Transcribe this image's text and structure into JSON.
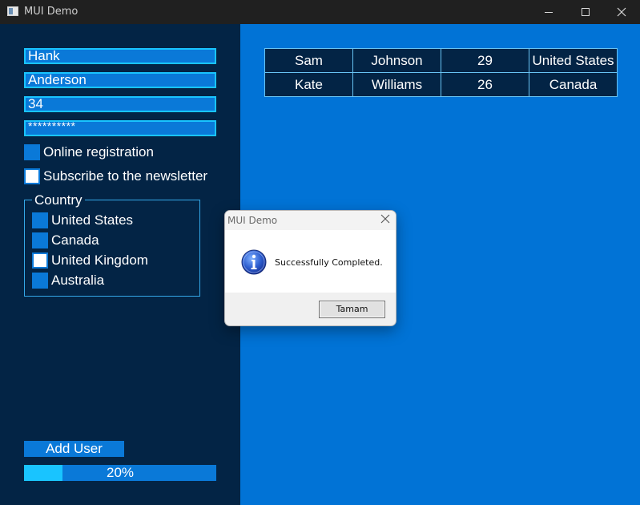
{
  "window": {
    "title": "MUI Demo"
  },
  "form": {
    "first_name": "Hank",
    "last_name": "Anderson",
    "age": "34",
    "password": "**********",
    "online_registration_label": "Online registration",
    "online_registration_checked": false,
    "newsletter_label": "Subscribe to the newsletter",
    "newsletter_checked": true
  },
  "country_group": {
    "title": "Country",
    "options": [
      {
        "label": "United States",
        "selected": false
      },
      {
        "label": "Canada",
        "selected": false
      },
      {
        "label": "United Kingdom",
        "selected": true
      },
      {
        "label": "Australia",
        "selected": false
      }
    ]
  },
  "actions": {
    "add_user_label": "Add User"
  },
  "progress": {
    "value": 0.2,
    "label": "20%"
  },
  "table": {
    "rows": [
      [
        "Sam",
        "Johnson",
        "29",
        "United States"
      ],
      [
        "Kate",
        "Williams",
        "26",
        "Canada"
      ]
    ]
  },
  "dialog": {
    "title": "MUI Demo",
    "message": "Successfully Completed.",
    "ok_label": "Tamam",
    "icon": "info-icon"
  },
  "colors": {
    "left_panel": "#032445",
    "right_panel": "#0173d6",
    "control": "#0a79d8",
    "accent": "#19c4ff"
  }
}
